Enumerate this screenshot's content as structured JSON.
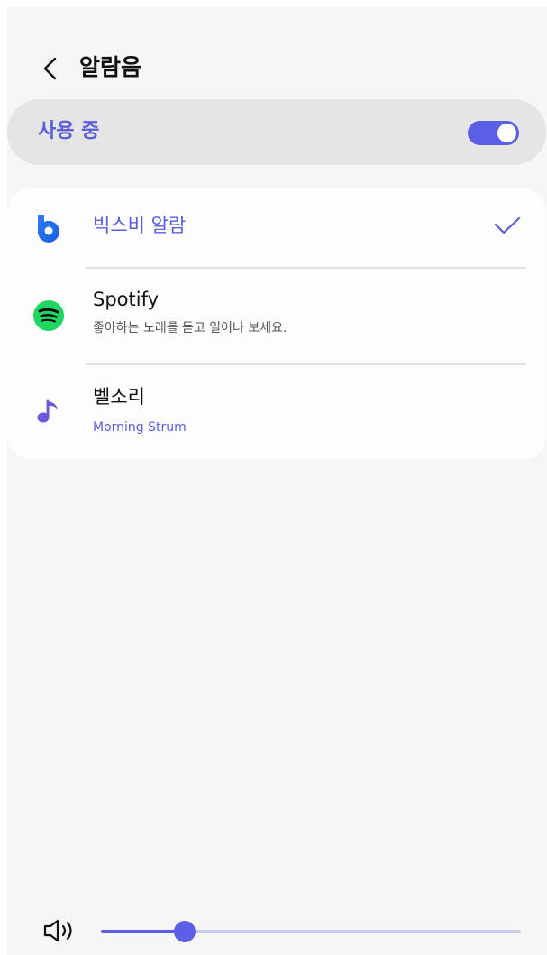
{
  "header": {
    "title": "알람음",
    "back_icon": "chevron-left-icon"
  },
  "master_switch": {
    "label": "사용 중",
    "on": true
  },
  "sound_options": [
    {
      "title": "빅스비 알람",
      "subtitle": "",
      "icon": "bixby-icon",
      "selected": true
    },
    {
      "title": "Spotify",
      "subtitle": "좋아하는 노래를 듣고 일어나 보세요.",
      "icon": "spotify-icon",
      "selected": false
    },
    {
      "title": "벨소리",
      "subtitle": "Morning Strum",
      "icon": "music-note-icon",
      "selected": false
    }
  ],
  "volume": {
    "icon": "volume-icon",
    "level": 0.2
  },
  "colors": {
    "accent": "#5b5fe3",
    "accent_text": "#5a5fd8",
    "spotify_green": "#1ed760",
    "background": "#f6f6f6"
  }
}
